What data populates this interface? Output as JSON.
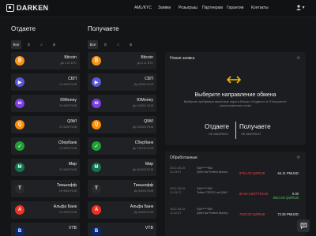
{
  "header": {
    "logo": "DARKEN",
    "nav": [
      "AML/KYC",
      "Заявки",
      "Розыгрыш",
      "Партнерам",
      "Гарантии",
      "Контакты"
    ],
    "user_menu": "▾"
  },
  "give": {
    "title": "Отдаете",
    "filters": [
      "Все",
      "₿",
      "≡",
      "⊞"
    ],
    "items": [
      {
        "name": "Bitcoin",
        "limit": "До 0,02 BTC",
        "icon": "bitcoin-icon",
        "color": "#f7931a",
        "glyph": "₿"
      },
      {
        "name": "СБП",
        "limit": "От 5000 RUB",
        "icon": "sbp-icon",
        "color": "#5b57d6",
        "glyph": "▶"
      },
      {
        "name": "ЮMoney",
        "limit": "От 5000 RUB",
        "icon": "yoomoney-icon",
        "color": "#7b3fe4",
        "glyph": "ю"
      },
      {
        "name": "QIWI",
        "limit": "От 5000 RUB",
        "icon": "qiwi-icon",
        "color": "#ff8c00",
        "glyph": "Q"
      },
      {
        "name": "Сбербанк",
        "limit": "От 5000 RUB",
        "icon": "sberbank-icon",
        "color": "#21a038",
        "glyph": "✓"
      },
      {
        "name": "Мир",
        "limit": "От 5000 RUB",
        "icon": "mir-icon",
        "color": "#0f754e",
        "glyph": "M"
      },
      {
        "name": "Тинькофф",
        "limit": "От 5000 RUB",
        "icon": "tinkoff-icon",
        "color": "#2b2b2b",
        "glyph": "T"
      },
      {
        "name": "Альфа Банк",
        "limit": "От 5000 RUB",
        "icon": "alfa-icon",
        "color": "#ef3124",
        "glyph": "A"
      },
      {
        "name": "VTB",
        "limit": "",
        "icon": "vtb-icon",
        "color": "#0a2973",
        "glyph": "B"
      }
    ]
  },
  "get": {
    "title": "Получаете",
    "filters": [
      "Все",
      "₿",
      "≡",
      "⊞"
    ],
    "items": [
      {
        "name": "Bitcoin",
        "limit": "До 0,11 BTC",
        "icon": "bitcoin-icon",
        "color": "#f7931a",
        "glyph": "₿"
      },
      {
        "name": "СБП",
        "limit": "До 50000 RUB",
        "icon": "sbp-icon",
        "color": "#5b57d6",
        "glyph": "▶"
      },
      {
        "name": "ЮMoney",
        "limit": "До 419201 RUB",
        "icon": "yoomoney-icon",
        "color": "#7b3fe4",
        "glyph": "ю"
      },
      {
        "name": "QIWI",
        "limit": "До 241004 RUB",
        "icon": "qiwi-icon",
        "color": "#ff8c00",
        "glyph": "Q"
      },
      {
        "name": "Сбербанк",
        "limit": "До 715713 RUB",
        "icon": "sberbank-icon",
        "color": "#21a038",
        "glyph": "✓"
      },
      {
        "name": "Мир",
        "limit": "До 461403 RUB",
        "icon": "mir-icon",
        "color": "#0f754e",
        "glyph": "M"
      },
      {
        "name": "Тинькофф",
        "limit": "До 50000 RUB",
        "icon": "tinkoff-icon",
        "color": "#2b2b2b",
        "glyph": "T"
      },
      {
        "name": "Альфа Банк",
        "limit": "До 50000 RUB",
        "icon": "alfa-icon",
        "color": "#ef3124",
        "glyph": "A"
      },
      {
        "name": "VTB",
        "limit": "",
        "icon": "vtb-icon",
        "color": "#0a2973",
        "glyph": "B"
      }
    ]
  },
  "new_order": {
    "title": "Новая заявка",
    "heading": "Выберите направление обмена",
    "description": "Выберите требуемые валютные пары в блоках «Отдаете» и «Получаете» расположенных слева",
    "give_label": "Отдаете",
    "give_status": "НЕ ВЫБРАНО",
    "get_label": "Получаете",
    "get_status": "НЕ ВЫБРАНО"
  },
  "processed": {
    "title": "Обработанные",
    "orders": [
      {
        "date": "2022-08-25",
        "time": "11:03:57",
        "who": "918*****902",
        "direction": "QIWI на Perfect Money",
        "out": "9751.00 QWRUB",
        "in": "64.11 PMUSD",
        "in2": ""
      },
      {
        "date": "2022-08-25",
        "time": "11:03:27",
        "who": "918*****251",
        "direction": "Tether TRC20 на QIWI",
        "out": "80.00 USDTTRC20",
        "in": "0.00",
        "in2": "8824.05 QWRUB"
      },
      {
        "date": "2022-08-25",
        "time": "11:02:57",
        "who": "918*****952",
        "direction": "QIWI на Perfect Money",
        "out": "7620.00 QWRUB",
        "in": "72.36 PMUSD",
        "in2": ""
      }
    ]
  },
  "chat": {
    "icon": "chat-icon"
  }
}
